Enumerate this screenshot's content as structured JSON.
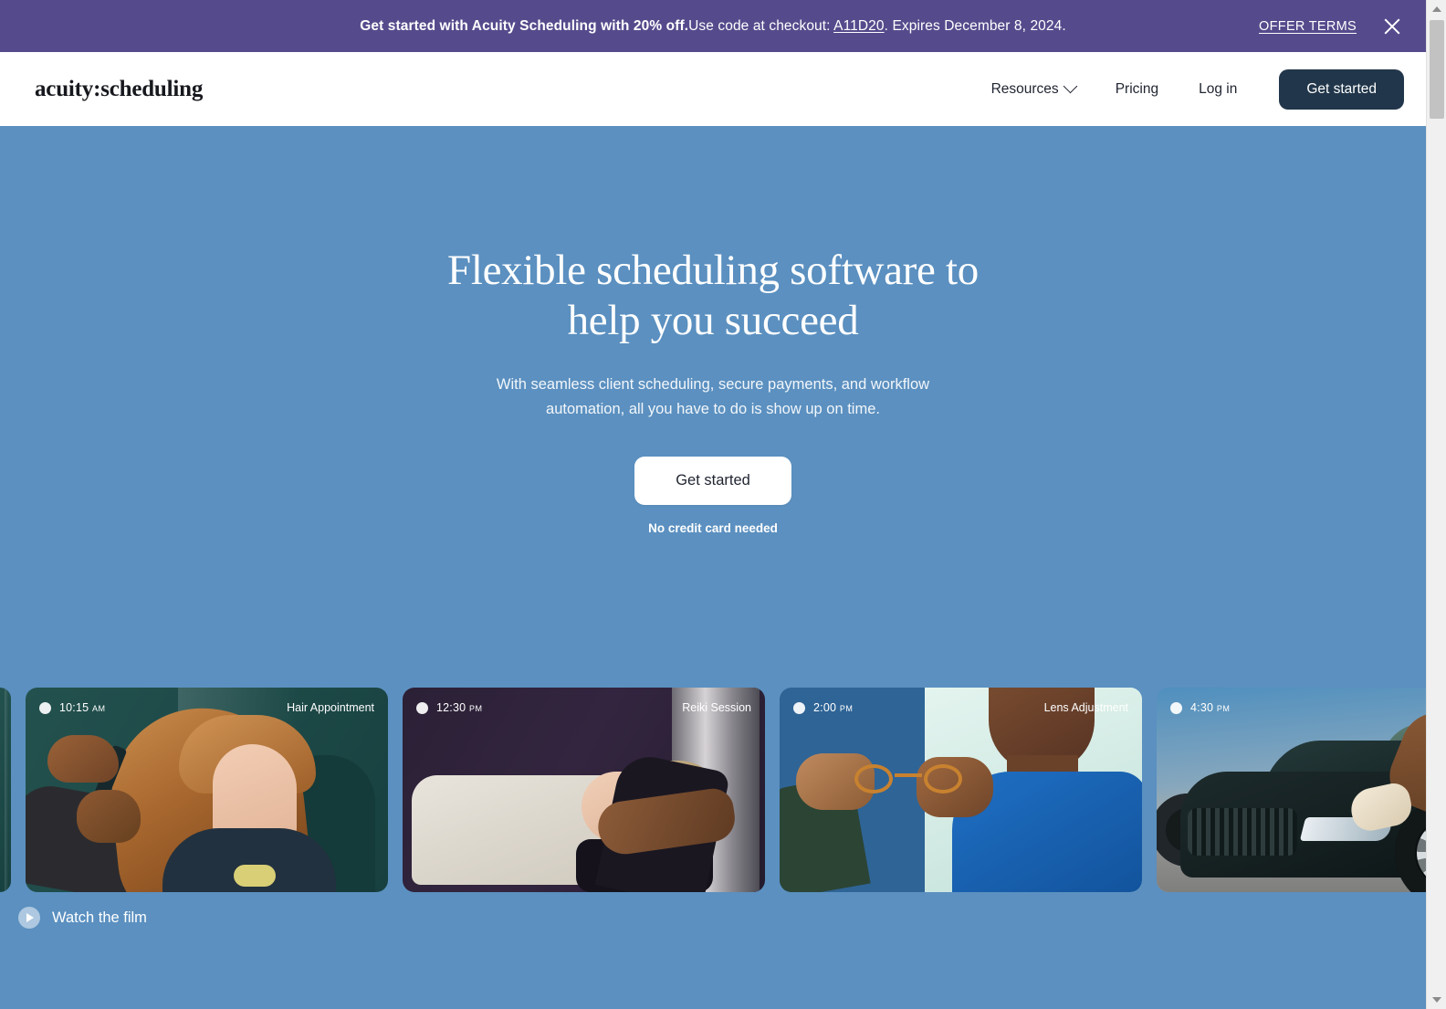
{
  "promo": {
    "headline": "Get started with Acuity Scheduling with 20% off.",
    "body_before_code": "Use code at checkout: ",
    "code": "A11D20",
    "body_after_code": ". Expires December 8, 2024.",
    "terms_label": "OFFER TERMS",
    "close_label": "Close",
    "background_color": "#554b8c"
  },
  "header": {
    "logo": "acuity:scheduling",
    "nav": [
      {
        "label": "Resources",
        "has_dropdown": true
      },
      {
        "label": "Pricing",
        "has_dropdown": false
      },
      {
        "label": "Log in",
        "has_dropdown": false
      }
    ],
    "cta_label": "Get started",
    "cta_color": "#21364a"
  },
  "hero": {
    "title_line_1": "Flexible scheduling software to",
    "title_line_2": "help you succeed",
    "subtitle_line_1": "With seamless client scheduling, secure payments, and workflow",
    "subtitle_line_2": "automation, all you have to do is show up on time.",
    "cta_label": "Get started",
    "cta_note": "No credit card needed",
    "background_color": "#5b90c0"
  },
  "carousel": {
    "cards": [
      {
        "time": "10:15",
        "ampm": "AM",
        "service": "Hair Appointment"
      },
      {
        "time": "12:30",
        "ampm": "PM",
        "service": "Reiki Session"
      },
      {
        "time": "2:00",
        "ampm": "PM",
        "service": "Lens Adjustment"
      },
      {
        "time": "4:30",
        "ampm": "PM",
        "service": ""
      }
    ]
  },
  "watch_film": {
    "label": "Watch the film"
  }
}
